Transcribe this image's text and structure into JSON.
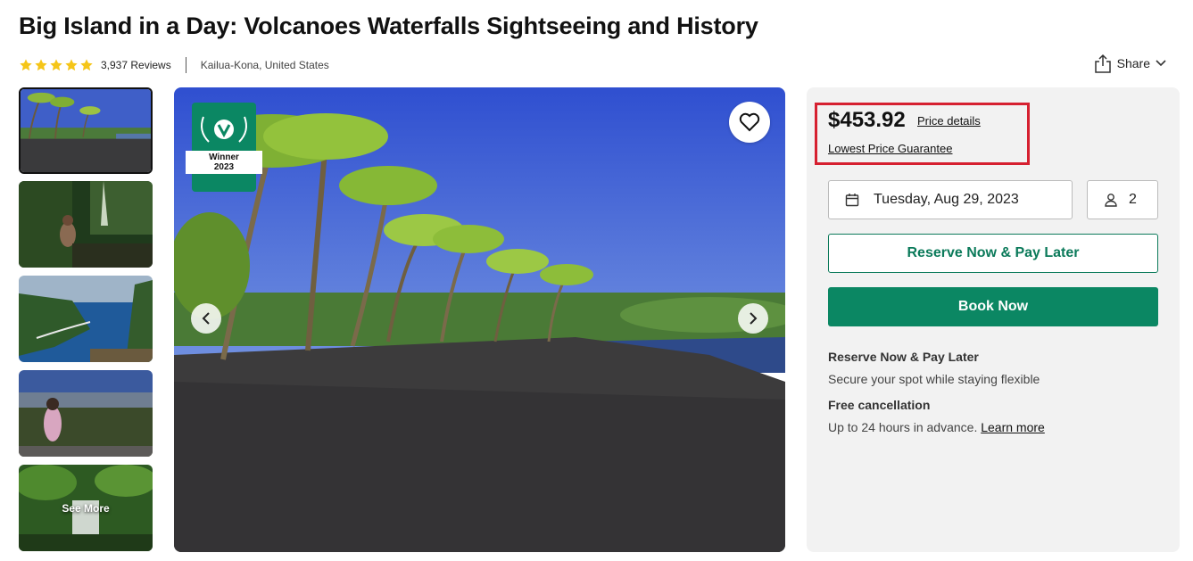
{
  "header": {
    "title": "Big Island in a Day: Volcanoes Waterfalls Sightseeing and History",
    "rating_stars": 5,
    "reviews": "3,937 Reviews",
    "location": "Kailua-Kona, United States",
    "share_label": "Share"
  },
  "gallery": {
    "thumbnails": [
      {
        "icon": "black-sand-beach-photo"
      },
      {
        "icon": "forest-trail-photo"
      },
      {
        "icon": "coastal-cliffs-photo"
      },
      {
        "icon": "lava-field-photo"
      },
      {
        "icon": "waterfall-photo"
      }
    ],
    "see_more_label": "See More",
    "badge": {
      "line1": "Winner",
      "line2": "2023"
    }
  },
  "booking": {
    "price": "$453.92",
    "price_details_label": "Price details",
    "lowest_price_label": "Lowest Price Guarantee",
    "date": "Tuesday, Aug 29, 2023",
    "travelers": "2",
    "reserve_label": "Reserve Now & Pay Later",
    "book_label": "Book Now",
    "info": [
      {
        "title": "Reserve Now & Pay Later",
        "text": "Secure your spot while staying flexible"
      },
      {
        "title": "Free cancellation",
        "text": "Up to 24 hours in advance.",
        "link": "Learn more"
      }
    ]
  },
  "colors": {
    "accent_green": "#0b8763",
    "highlight_red": "#d62030",
    "star_yellow": "#f5c518"
  }
}
